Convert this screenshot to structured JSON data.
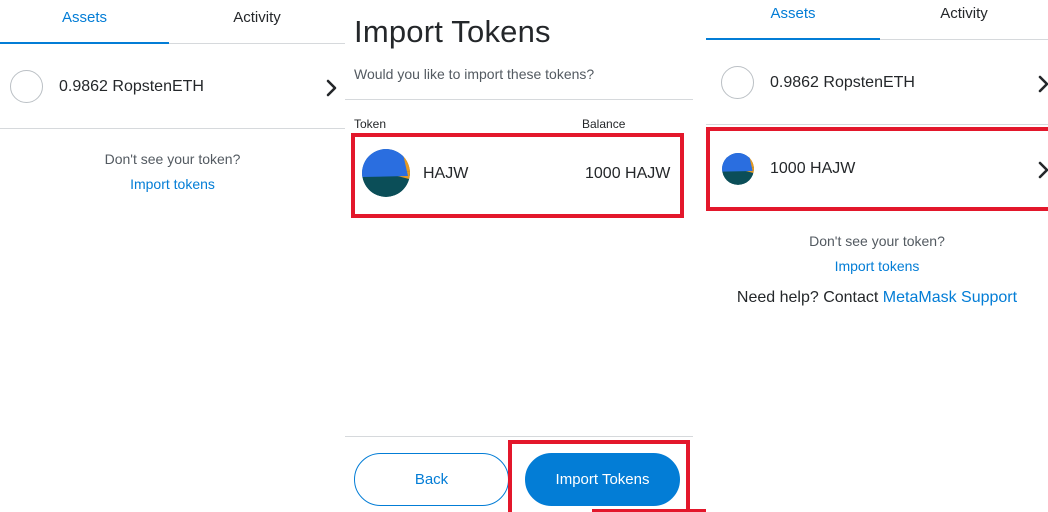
{
  "left": {
    "tabs": [
      {
        "label": "Assets",
        "active": true
      },
      {
        "label": "Activity",
        "active": false
      }
    ],
    "asset": {
      "label": "0.9862 RopstenETH"
    },
    "hint": "Don't see your token?",
    "import_link": "Import tokens"
  },
  "middle": {
    "title": "Import Tokens",
    "subtitle": "Would you like to import these tokens?",
    "columns": {
      "token": "Token",
      "balance": "Balance"
    },
    "token": {
      "symbol": "HAJW",
      "balance": "1000 HAJW"
    },
    "buttons": {
      "back": "Back",
      "import": "Import Tokens"
    }
  },
  "right": {
    "tabs": [
      {
        "label": "Assets",
        "active": true
      },
      {
        "label": "Activity",
        "active": false
      }
    ],
    "assets": [
      {
        "label": "0.9862 RopstenETH"
      },
      {
        "label": "1000 HAJW"
      }
    ],
    "hint": "Don't see your token?",
    "import_link": "Import tokens",
    "help": {
      "prefix": "Need help? Contact",
      "link": "MetaMask Support"
    }
  },
  "colors": {
    "accent": "#037dd6",
    "highlight_red": "#e3172b",
    "token_blue": "#2a6ee0",
    "token_orange": "#e69a21",
    "token_teal": "#0b4e58"
  },
  "icons": [
    "chevron-right-icon",
    "token-identicon",
    "asset-placeholder-circle"
  ]
}
